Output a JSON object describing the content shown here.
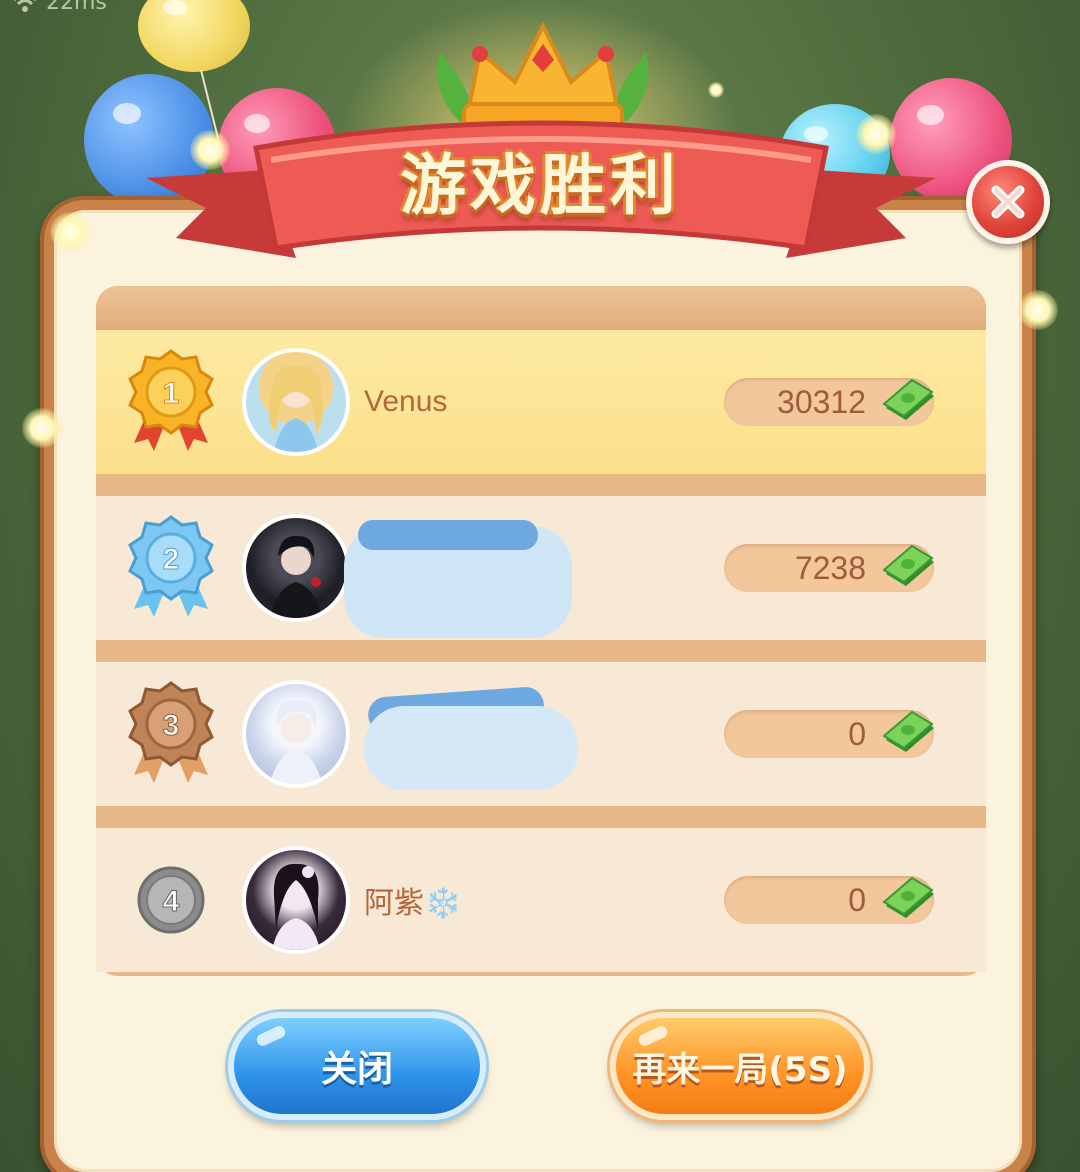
{
  "status": {
    "ping": "22ms",
    "icon": "wifi-icon"
  },
  "header": {
    "title": "游戏胜利",
    "crown_icon": "crown-icon",
    "close_icon": "close-icon"
  },
  "leaderboard": {
    "rows": [
      {
        "rank": "1",
        "name": "Venus",
        "score": "30312",
        "medal_color": "#f3a21e",
        "avatar_icon": "avatar-icon"
      },
      {
        "rank": "2",
        "name": "",
        "score": "7238",
        "medal_color": "#5fb8ef",
        "avatar_icon": "avatar-icon"
      },
      {
        "rank": "3",
        "name": "",
        "score": "0",
        "medal_color": "#b57a4a",
        "avatar_icon": "avatar-icon"
      },
      {
        "rank": "4",
        "name": "阿紫❄️",
        "score": "0",
        "medal_color": "#8a8a8a",
        "avatar_icon": "avatar-icon"
      }
    ],
    "currency_icon": "cash-icon"
  },
  "buttons": {
    "close_label": "关闭",
    "again_label": "再来一局(5S)"
  },
  "colors": {
    "panel": "#c9824a",
    "panel_inner": "#fbf3dd",
    "first_row": "#fce49a",
    "text_brown": "#a05c3a"
  }
}
